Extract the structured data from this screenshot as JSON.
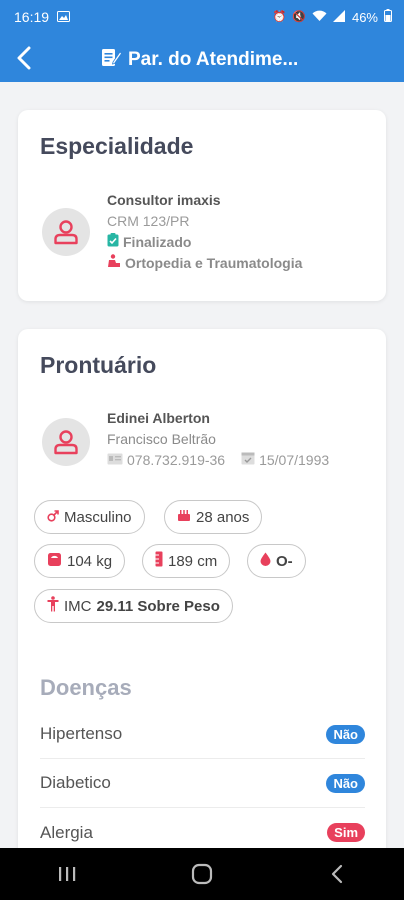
{
  "status_bar": {
    "time": "16:19",
    "battery": "46%"
  },
  "app_bar": {
    "title": "Par. do Atendime..."
  },
  "specialty_card": {
    "title": "Especialidade",
    "doctor_name": "Consultor imaxis",
    "crm": "CRM 123/PR",
    "status": "Finalizado",
    "specialty": "Ortopedia e Traumatologia"
  },
  "record_card": {
    "title": "Prontuário",
    "patient_name": "Edinei Alberton",
    "city": "Francisco Beltrão",
    "cpf": "078.732.919-36",
    "birth_date": "15/07/1993",
    "chips": {
      "sex": "Masculino",
      "age": "28 anos",
      "weight": "104 kg",
      "height": "189 cm",
      "blood_type": "O-",
      "imc_label": "IMC",
      "imc_value": "29.11 Sobre Peso"
    },
    "diseases_title": "Doenças",
    "diseases": [
      {
        "label": "Hipertenso",
        "value": "Não",
        "color": "#2f86dc"
      },
      {
        "label": "Diabetico",
        "value": "Não",
        "color": "#2f86dc"
      },
      {
        "label": "Alergia",
        "value": "Sim",
        "color": "#e8405c"
      }
    ]
  },
  "colors": {
    "primary": "#2f86dc",
    "accent": "#e8405c",
    "status_ok": "#27b6a4"
  }
}
